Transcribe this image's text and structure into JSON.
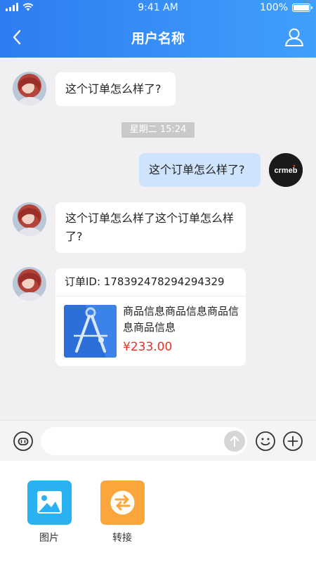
{
  "status_bar": {
    "time": "9:41 AM",
    "battery": "100%"
  },
  "nav": {
    "title": "用户名称"
  },
  "messages": [
    {
      "text": "这个订单怎么样了?"
    },
    {
      "text": "这个订单怎么样了?"
    },
    {
      "text": "这个订单怎么样了这个订单怎么样了?"
    }
  ],
  "timestamp": "星期二  15:24",
  "order": {
    "id_label": "订单ID: 178392478294294329",
    "product_name": "商品信息商品信息商品信息商品信息",
    "price": "¥233.00"
  },
  "logo_text": "crmeb",
  "input": {
    "value": "",
    "placeholder": ""
  },
  "tools": [
    {
      "label": "图片",
      "icon": "image-icon",
      "color": "#29b1f3"
    },
    {
      "label": "转接",
      "icon": "transfer-icon",
      "color": "#fba63a"
    }
  ],
  "colors": {
    "header_start": "#2f7cf2",
    "header_end": "#3fa0fb",
    "price": "#e93323",
    "my_bubble": "#cfe3fd"
  }
}
